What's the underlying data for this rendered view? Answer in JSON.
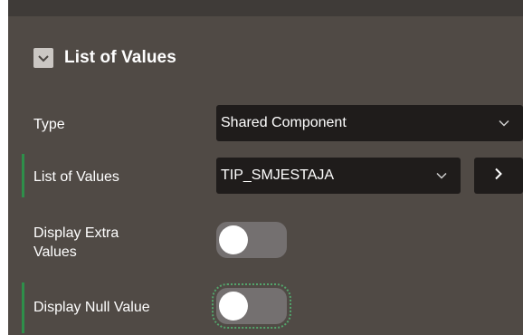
{
  "section": {
    "title": "List of Values",
    "collapse_icon": "chevron-down-icon",
    "expanded": true
  },
  "fields": {
    "type": {
      "label": "Type",
      "value": "Shared Component",
      "icon": "chevron-down-icon"
    },
    "list_of_values": {
      "label": "List of Values",
      "value": "TIP_SMJESTAJA",
      "icon": "chevron-down-icon",
      "nav_icon": "chevron-right-icon",
      "modified": true
    },
    "display_extra_values": {
      "label_line1": "Display Extra",
      "label_line2": "Values",
      "on": false
    },
    "display_null_value": {
      "label": "Display Null Value",
      "on": false,
      "modified": true,
      "focused": true
    }
  },
  "colors": {
    "panel_bg": "#504a45",
    "control_bg": "#1f1c1b",
    "modified_bar": "#2e8f4a",
    "toggle_track": "#747070",
    "text": "#ffffff"
  }
}
